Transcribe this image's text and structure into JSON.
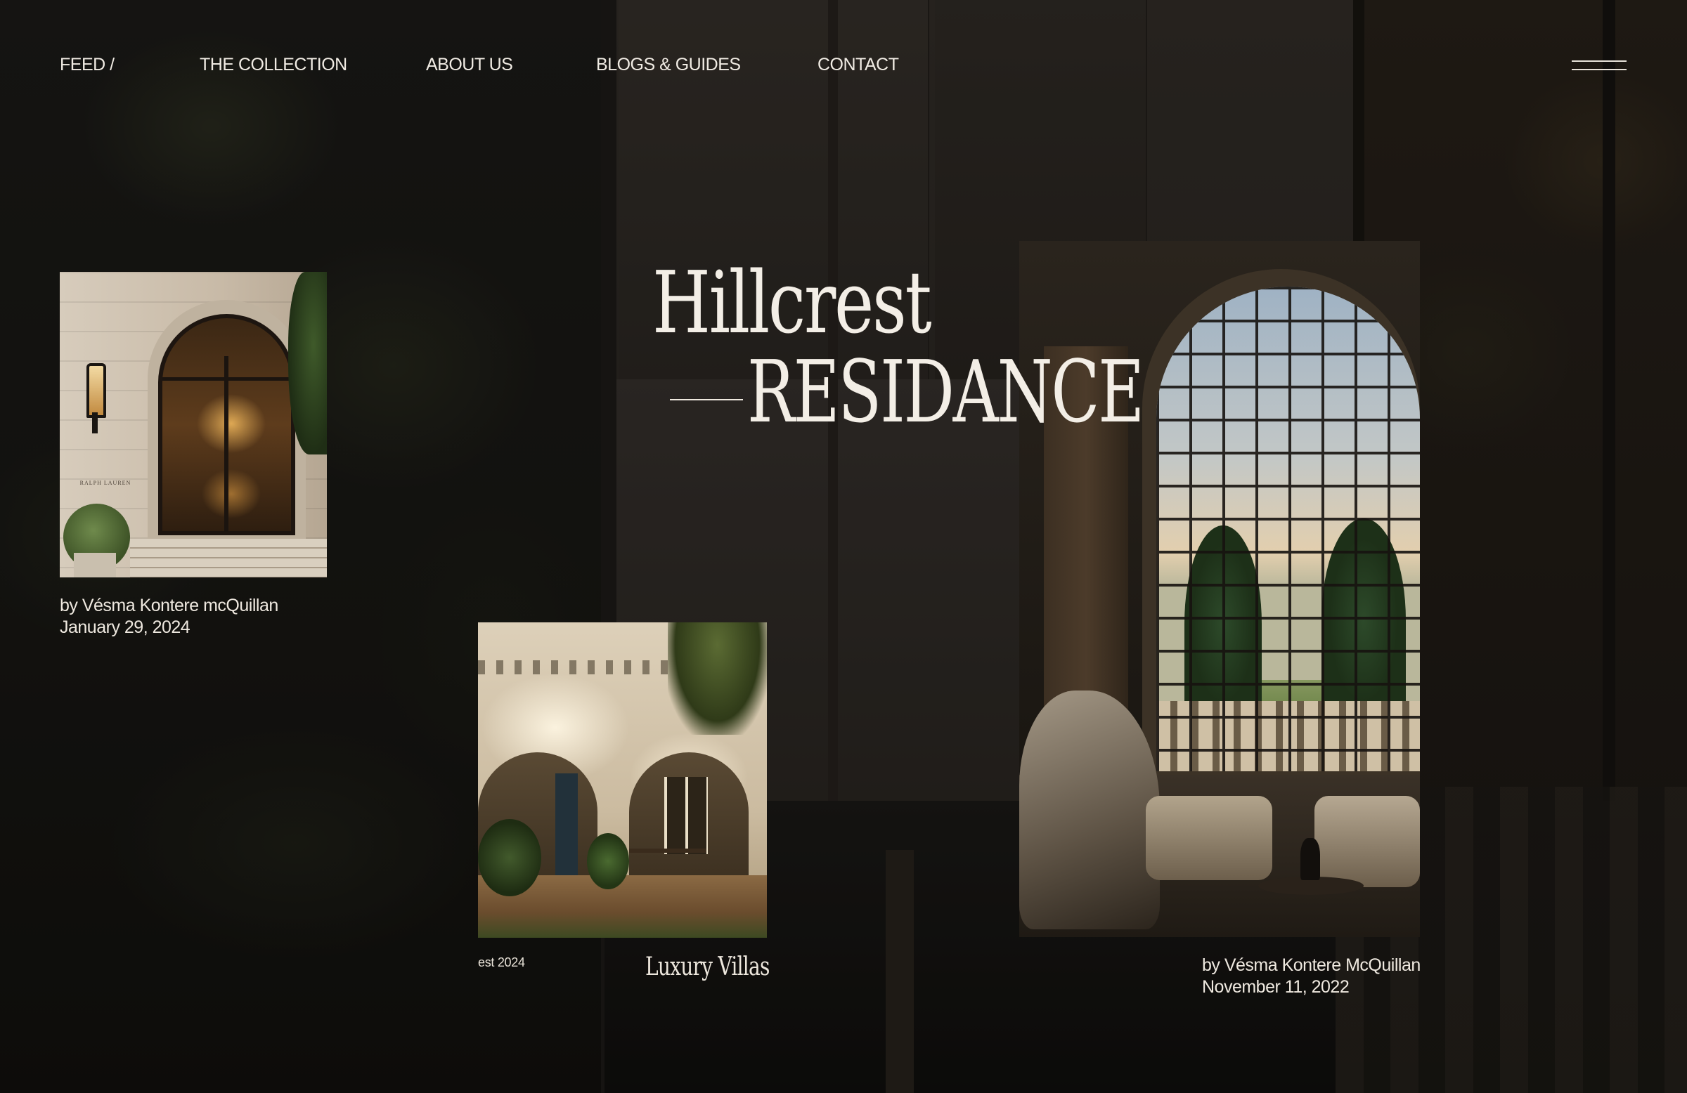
{
  "nav": {
    "items": [
      {
        "label": "FEED /"
      },
      {
        "label": "THE COLLECTION"
      },
      {
        "label": "ABOUT US"
      },
      {
        "label": "BLOGS & GUIDES"
      },
      {
        "label": "CONTACT"
      }
    ],
    "menu_icon": "hamburger-menu-icon"
  },
  "hero": {
    "title_line1": "Hillcrest",
    "title_line2": "RESIDANCE"
  },
  "cards": {
    "first": {
      "image_label": "RALPH LAUREN",
      "author": "by Vésma Kontere mcQuillan",
      "date": "January 29, 2024"
    },
    "second": {
      "est": "est 2024",
      "label": "Luxury Villas"
    },
    "third": {
      "author": "by Vésma Kontere McQuillan",
      "date": "November 11, 2022"
    }
  },
  "colors": {
    "background": "#151311",
    "text": "#f2ede6"
  }
}
